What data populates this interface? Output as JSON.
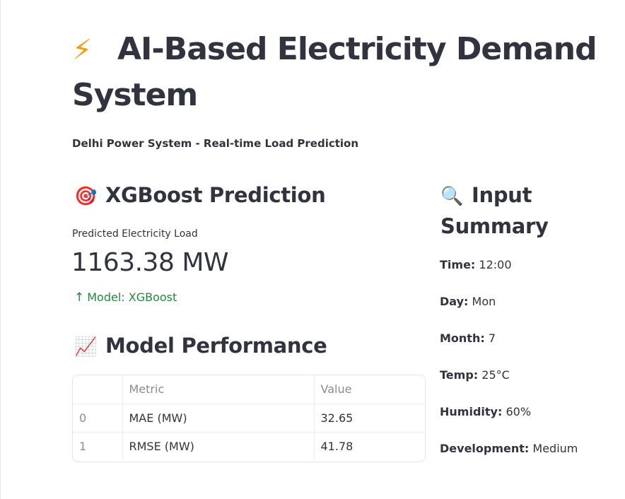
{
  "header": {
    "emoji": "⚡",
    "title": "AI-Based Electricity Demand System",
    "subtitle": "Delhi Power System - Real-time Load Prediction"
  },
  "prediction": {
    "emoji": "🎯",
    "heading": "XGBoost Prediction",
    "label": "Predicted Electricity Load",
    "value": "1163.38 MW",
    "delta_arrow": "↑",
    "delta": "Model: XGBoost"
  },
  "performance": {
    "emoji": "📈",
    "heading": "Model Performance",
    "columns": [
      "",
      "Metric",
      "Value"
    ],
    "rows": [
      {
        "index": "0",
        "metric": "MAE (MW)",
        "value": "32.65"
      },
      {
        "index": "1",
        "metric": "RMSE (MW)",
        "value": "41.78"
      }
    ]
  },
  "input_summary": {
    "emoji": "🔍",
    "heading": "Input Summary",
    "items": [
      {
        "label": "Time:",
        "value": "12:00"
      },
      {
        "label": "Day:",
        "value": "Mon"
      },
      {
        "label": "Month:",
        "value": "7"
      },
      {
        "label": "Temp:",
        "value": "25°C"
      },
      {
        "label": "Humidity:",
        "value": "60%"
      },
      {
        "label": "Development:",
        "value": "Medium"
      }
    ]
  },
  "colors": {
    "text": "#31333f",
    "delta_green": "#21883e",
    "muted": "#8a8c95"
  }
}
